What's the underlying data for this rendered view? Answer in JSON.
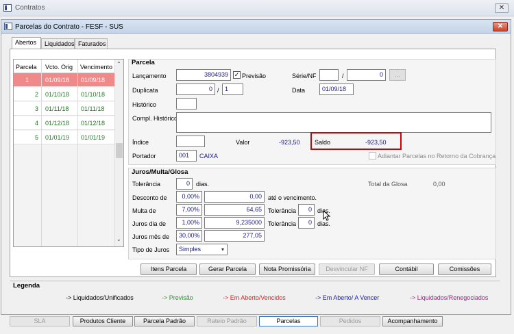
{
  "outer_window": {
    "title": "Contratos",
    "close_label": "✕"
  },
  "window": {
    "title": "Parcelas do Contrato - FESF - SUS",
    "close_label": "✕"
  },
  "tabs": [
    {
      "label": "Abertos"
    },
    {
      "label": "Liquidados"
    },
    {
      "label": "Faturados"
    }
  ],
  "grid": {
    "headers": [
      "Parcela",
      "Vcto. Orig",
      "Vencimento"
    ],
    "rows": [
      {
        "parcela": "1",
        "vcto_orig": "01/09/18",
        "vencimento": "01/09/18"
      },
      {
        "parcela": "2",
        "vcto_orig": "01/10/18",
        "vencimento": "01/10/18"
      },
      {
        "parcela": "3",
        "vcto_orig": "01/11/18",
        "vencimento": "01/11/18"
      },
      {
        "parcela": "4",
        "vcto_orig": "01/12/18",
        "vencimento": "01/12/18"
      },
      {
        "parcela": "5",
        "vcto_orig": "01/01/19",
        "vencimento": "01/01/19"
      }
    ]
  },
  "parcela": {
    "title": "Parcela",
    "lancamento_label": "Lançamento",
    "lancamento_value": "3804939",
    "previsao_label": "Previsão",
    "serie_nf_label": "Série/NF",
    "serie_value": "",
    "nf_sep": "/",
    "nf_value": "0",
    "nf_lookup": "...",
    "duplicata_label": "Duplicata",
    "duplicata_value": "0",
    "duplicata_sep": "/",
    "duplicata_seq": "1",
    "data_label": "Data",
    "data_value": "01/09/18",
    "historico_label": "Histórico",
    "historico_value": "",
    "compl_historico_label": "Compl. Histórico",
    "compl_historico_value": "",
    "indice_label": "Índice",
    "indice_value": "",
    "valor_label": "Valor",
    "valor_value": "-923,50",
    "saldo_label": "Saldo",
    "saldo_value": "-923,50",
    "portador_label": "Portador",
    "portador_code": "001",
    "portador_name": "CAIXA",
    "adiantar_label": "Adiantar Parcelas no Retorno da Cobrança"
  },
  "juros": {
    "title": "Juros/Multa/Glosa",
    "tolerancia_label": "Tolerância",
    "tolerancia_value": "0",
    "dias_label": "dias.",
    "total_glosa_label": "Total da Glosa",
    "total_glosa_value": "0,00",
    "desconto_label": "Desconto de",
    "desconto_pct": "0,00%",
    "desconto_value": "0,00",
    "ate_vencimento_label": "até o vencimento.",
    "multa_label": "Multa de",
    "multa_pct": "7,00%",
    "multa_value": "64,65",
    "multa_tol_label": "Tolerância",
    "multa_tol_value": "0",
    "multa_dias_label": "dias.",
    "juros_dia_label": "Juros dia de",
    "juros_dia_pct": "1,00%",
    "juros_dia_value": "9,235000",
    "juros_tol_label": "Tolerância",
    "juros_tol_value": "0",
    "juros_dias_label": "dias.",
    "juros_mes_label": "Juros mês de",
    "juros_mes_pct": "30,00%",
    "juros_mes_value": "277,05",
    "tipo_juros_label": "Tipo de Juros",
    "tipo_juros_value": "Simples"
  },
  "actions": [
    {
      "label": "Itens Parcela"
    },
    {
      "label": "Gerar Parcela"
    },
    {
      "label": "Nota Promissória"
    },
    {
      "label": "Desvincular NF"
    },
    {
      "label": "Contábil"
    },
    {
      "label": "Comissões"
    }
  ],
  "legend": {
    "title": "Legenda",
    "items": [
      {
        "label": "-> Liquidados/Unificados",
        "color": "#000000"
      },
      {
        "label": "-> Previsão",
        "color": "#1e9a1e"
      },
      {
        "label": "-> Em Aberto/Vencidos",
        "color": "#e02020"
      },
      {
        "label": "-> Em Aberto/ A Vencer",
        "color": "#1a1ac0"
      },
      {
        "label": "-> Liquidados/Renegociados",
        "color": "#a0208a"
      }
    ]
  },
  "bottom_bar": [
    {
      "label": "SLA"
    },
    {
      "label": "Produtos Cliente"
    },
    {
      "label": "Parcela Padrão"
    },
    {
      "label": "Rateio Padrão"
    },
    {
      "label": "Parcelas"
    },
    {
      "label": "Pedidos"
    },
    {
      "label": "Acompanhamento"
    }
  ],
  "colors": {
    "selected_row": "#f08a8a",
    "highlight_border": "#d40000",
    "value_text": "#1a1a80"
  }
}
